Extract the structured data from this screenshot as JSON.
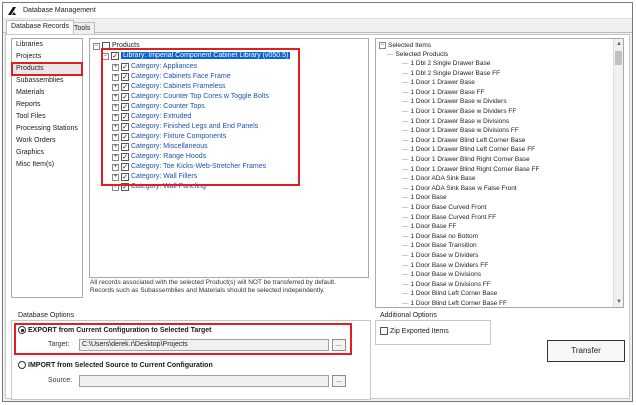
{
  "window": {
    "title": "Database Management"
  },
  "tabs": [
    {
      "label": "Database Records"
    },
    {
      "label": "Tools"
    }
  ],
  "nav": {
    "items": [
      {
        "label": "Libraries"
      },
      {
        "label": "Projects"
      },
      {
        "label": "Products"
      },
      {
        "label": "Subassemblies"
      },
      {
        "label": "Materials"
      },
      {
        "label": "Reports"
      },
      {
        "label": "Tool Files"
      },
      {
        "label": "Processing Stations"
      },
      {
        "label": "Work Orders"
      },
      {
        "label": "Graphics"
      },
      {
        "label": "Misc Item(s)"
      }
    ],
    "selected": "Products"
  },
  "tree": {
    "root": {
      "label": "Products"
    },
    "library": {
      "label": "Library: Imperial Component Cabinet Library (v050.5)"
    },
    "categories": [
      {
        "label": "Category: Appliances"
      },
      {
        "label": "Category: Cabinets Face Frame"
      },
      {
        "label": "Category: Cabinets Frameless"
      },
      {
        "label": "Category: Counter Top Cores w Toggle Bolts"
      },
      {
        "label": "Category: Counter Tops"
      },
      {
        "label": "Category: Extruded"
      },
      {
        "label": "Category: Finished Legs and End Panels"
      },
      {
        "label": "Category: Fixture Components"
      },
      {
        "label": "Category: Miscellaneous"
      },
      {
        "label": "Category: Range Hoods"
      },
      {
        "label": "Category: Toe Kicks-Web-Stretcher Frames"
      },
      {
        "label": "Category: Wall Fillers"
      },
      {
        "label": "Category: Wall Paneling"
      }
    ]
  },
  "note": {
    "line1": "All records associated with the selected Product(s) will NOT be transferred by default.",
    "line2": "Records such as Subassemblies and Materials should be selected independently."
  },
  "selected_items": {
    "root": "Selected Items",
    "group": "Selected Products",
    "items": [
      "1 Dbl 2 Single Drawer Base",
      "1 Dbl 2 Single Drawer Base FF",
      "1 Door 1 Drawer Base",
      "1 Door 1 Drawer Base FF",
      "1 Door 1 Drawer Base w Dividers",
      "1 Door 1 Drawer Base w Dividers FF",
      "1 Door 1 Drawer Base w Divisions",
      "1 Door 1 Drawer Base w Divisions FF",
      "1 Door 1 Drawer Blind Left Corner Base",
      "1 Door 1 Drawer Blind Left Corner Base FF",
      "1 Door 1 Drawer Blind Right Corner Base",
      "1 Door 1 Drawer Blind Right Corner Base FF",
      "1 Door ADA Sink Base",
      "1 Door ADA Sink Base w False Front",
      "1 Door Base",
      "1 Door Base Curved Front",
      "1 Door Base Curved Front FF",
      "1 Door Base FF",
      "1 Door Base no Bottom",
      "1 Door Base Transition",
      "1 Door Base w Dividers",
      "1 Door Base w Dividers FF",
      "1 Door Base w Divisions",
      "1 Door Base w Divisions FF",
      "1 Door Blind Left Corner Base",
      "1 Door Blind Left Corner Base FF"
    ]
  },
  "database_options": {
    "label": "Database Options",
    "export": {
      "label": "EXPORT from Current Configuration to Selected Target",
      "selected": true
    },
    "target": {
      "label": "Target:",
      "value": "C:\\Users\\derek.r\\Desktop\\Projects",
      "browse": "..."
    },
    "import": {
      "label": "IMPORT from Selected Source to Current Configuration",
      "selected": false
    },
    "source": {
      "label": "Source:",
      "value": "",
      "browse": "..."
    }
  },
  "additional_options": {
    "label": "Additional Options",
    "zip": {
      "label": "Zip Exported Items",
      "checked": false
    }
  },
  "transfer_button": {
    "label": "Transfer"
  },
  "colors": {
    "highlight_red": "#e02020",
    "selection_blue": "#0a64d6",
    "link_blue": "#1f4fb5"
  }
}
